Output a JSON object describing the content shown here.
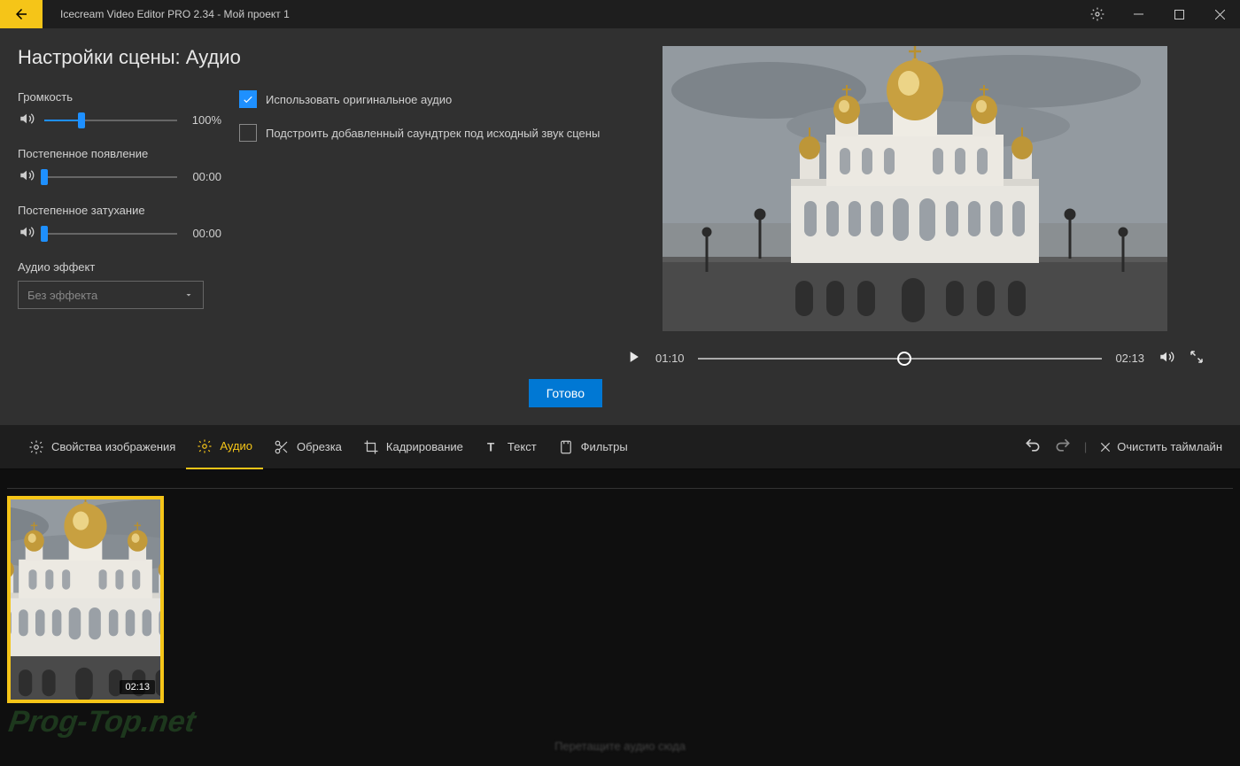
{
  "titlebar": {
    "app_title": "Icecream Video Editor PRO 2.34  -  Мой проект 1"
  },
  "panel": {
    "title": "Настройки сцены: Аудио",
    "sliders": {
      "volume": {
        "label": "Громкость",
        "value": "100%",
        "percent": 28
      },
      "fadein": {
        "label": "Постепенное появление",
        "value": "00:00",
        "percent": 0
      },
      "fadeout": {
        "label": "Постепенное затухание",
        "value": "00:00",
        "percent": 0
      }
    },
    "checks": {
      "use_original": {
        "label": "Использовать оригинальное аудио",
        "checked": true
      },
      "adjust_soundtrack": {
        "label": "Подстроить добавленный саундтрек под исходный звук сцены",
        "checked": false
      }
    },
    "effect": {
      "label": "Аудио эффект",
      "selected": "Без эффекта"
    },
    "done": "Готово"
  },
  "player": {
    "current": "01:10",
    "total": "02:13",
    "progress": 51
  },
  "tabs": {
    "image_props": "Свойства изображения",
    "audio": "Аудио",
    "cut": "Обрезка",
    "crop": "Кадрирование",
    "text": "Текст",
    "filters": "Фильтры",
    "clear": "Очистить таймлайн"
  },
  "timeline": {
    "clip_duration": "02:13",
    "audio_hint": "Перетащите аудио сюда"
  },
  "watermark": "Prog-Top.net"
}
